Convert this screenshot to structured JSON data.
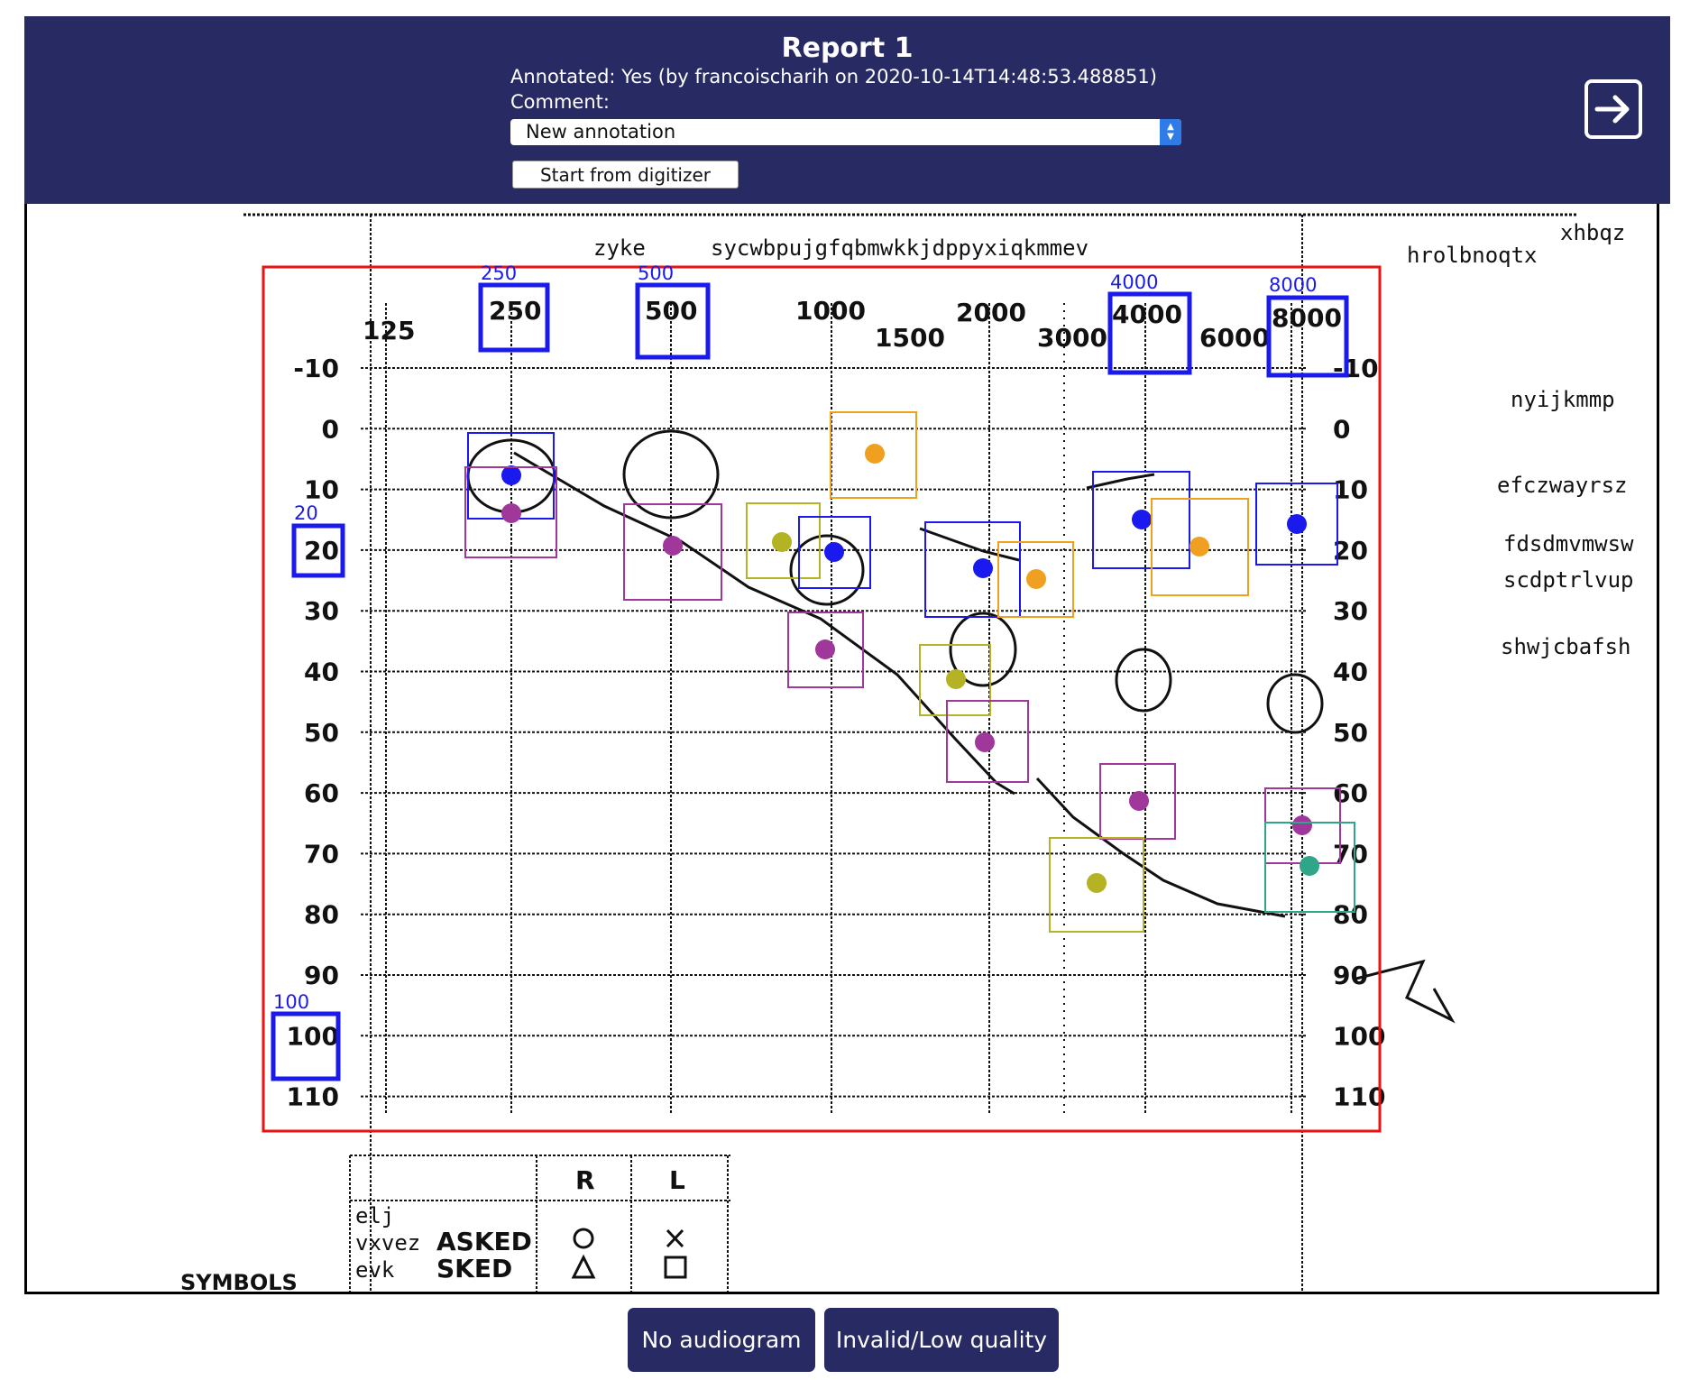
{
  "header": {
    "title": "Report 1",
    "annotated_text": "Annotated: Yes (by francoischarih on 2020-10-14T14:48:53.488851)",
    "comment_label": "Comment:",
    "select_value": "New annotation",
    "digitizer_button": "Start from digitizer",
    "next_icon": "arrow-right-box-icon"
  },
  "scan": {
    "title_fragment_1": "zyke",
    "title_fragment_2": "sycwbpujgfqbmwkkjdppyxiqkmmev",
    "right_notes": [
      "xhbqz",
      "hrolbnoqtx",
      "nyijkmmp",
      "efczwayrsz",
      "fdsdmvmwsw",
      "scdptrlvup",
      "shwjcbafsh"
    ],
    "legend_notes": [
      "elj",
      "vxvez",
      "evk"
    ],
    "freq_labels": [
      "125",
      "250",
      "500",
      "1000",
      "1500",
      "2000",
      "3000",
      "4000",
      "6000",
      "8000"
    ],
    "db_labels": [
      "-10",
      "0",
      "10",
      "20",
      "30",
      "40",
      "50",
      "60",
      "70",
      "80",
      "90",
      "100",
      "110"
    ],
    "symbols_label": "SYMBOLS",
    "legend_headers": [
      "R",
      "L"
    ],
    "legend_words": [
      "ASKED",
      "SKED"
    ]
  },
  "annotations": {
    "frequency_boxes": [
      "250",
      "500",
      "4000",
      "8000"
    ],
    "threshold_boxes": [
      "20",
      "100"
    ],
    "colors": {
      "region": "#ee1111",
      "axis_box": "#1a1aee",
      "blue": "#1a1aee",
      "purple": "#a0389c",
      "orange": "#f0a020",
      "olive": "#b3b324",
      "teal": "#2fa58a"
    }
  },
  "footer": {
    "no_audiogram": "No audiogram",
    "invalid": "Invalid/Low quality"
  }
}
